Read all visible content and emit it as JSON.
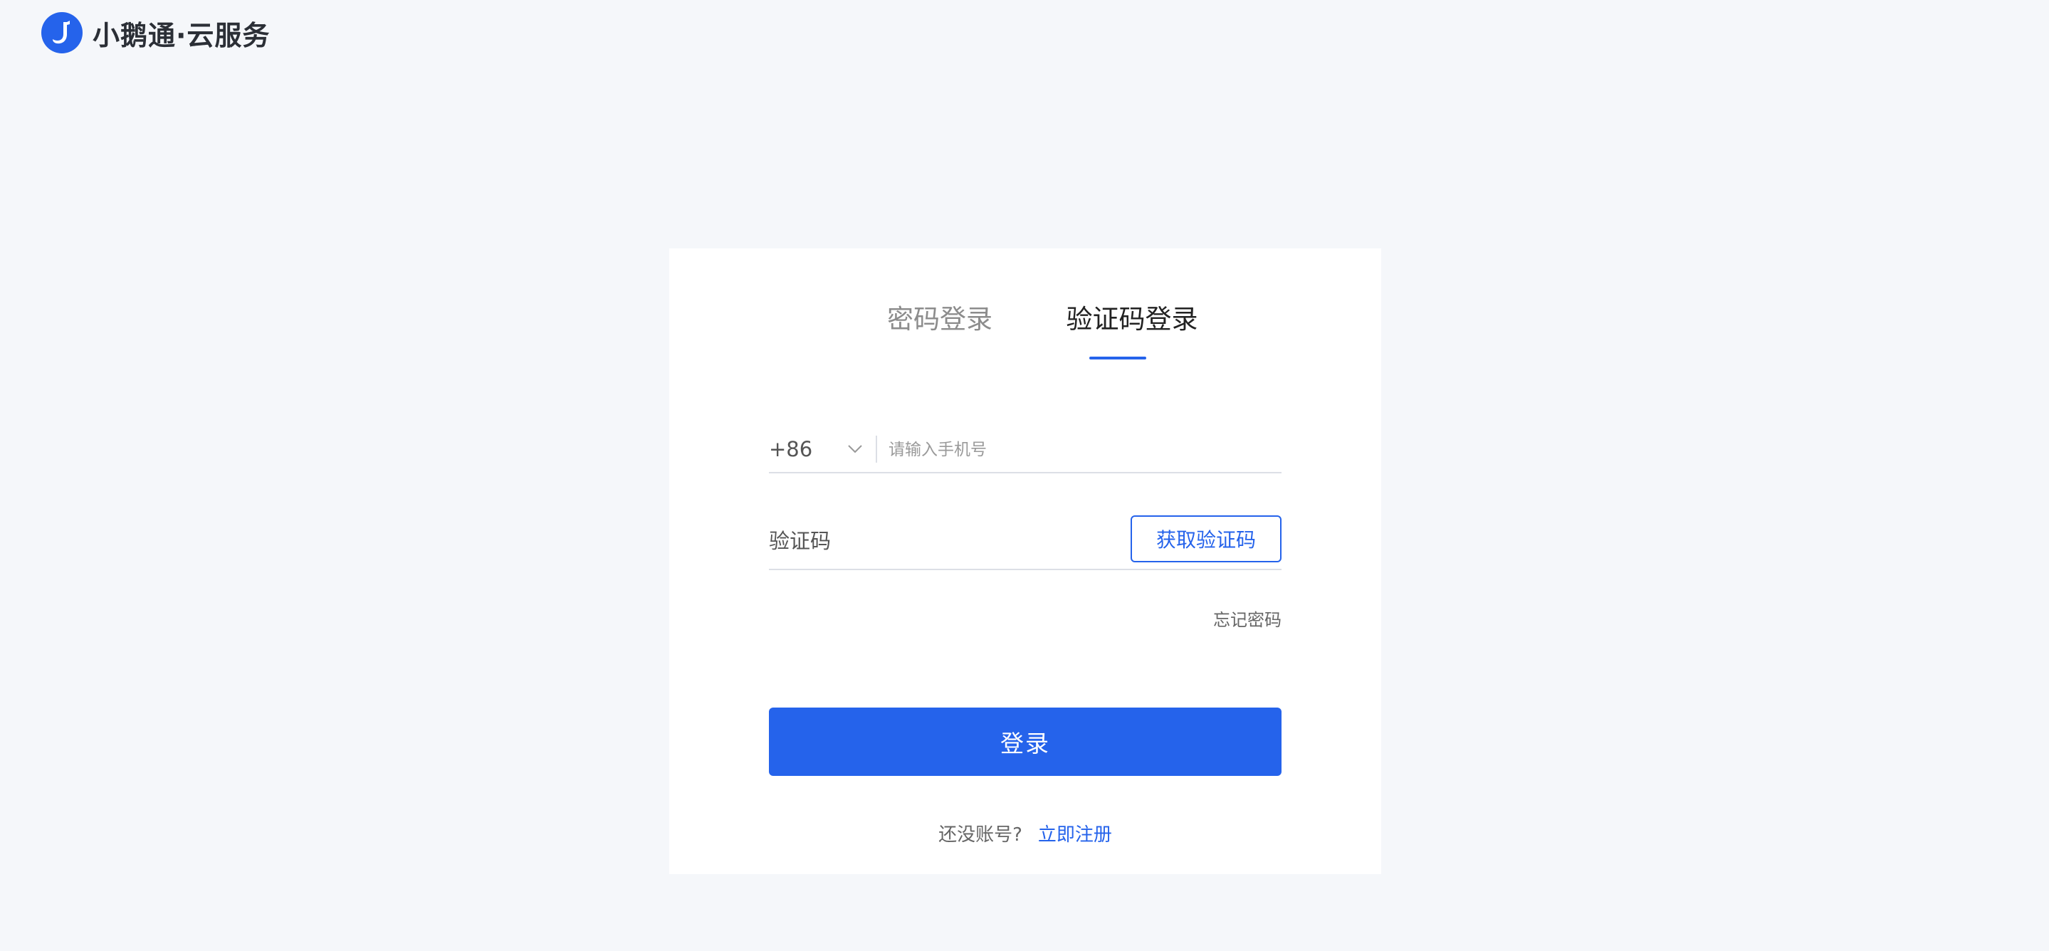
{
  "header": {
    "brand": "小鹅通·云服务",
    "logo_icon": "goose-logo-icon",
    "brand_color": "#2563eb"
  },
  "login": {
    "tabs": [
      {
        "label": "密码登录",
        "active": false
      },
      {
        "label": "验证码登录",
        "active": true
      }
    ],
    "phone": {
      "country_code": "+86",
      "placeholder": "请输入手机号",
      "value": ""
    },
    "code": {
      "placeholder": "验证码",
      "value": "",
      "get_code_label": "获取验证码"
    },
    "forgot_label": "忘记密码",
    "submit_label": "登录",
    "no_account_text": "还没账号?",
    "register_label": "立即注册",
    "accent_color": "#2563eb"
  }
}
